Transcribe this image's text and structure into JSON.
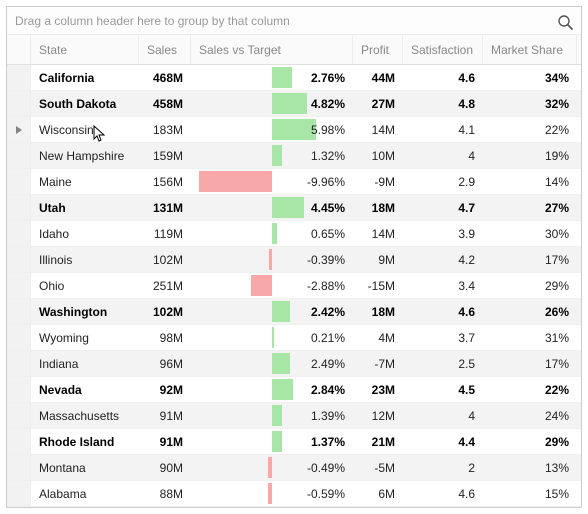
{
  "group_panel_text": "Drag a column header here to group by that column",
  "columns": {
    "state": "State",
    "sales": "Sales",
    "svt": "Sales vs Target",
    "profit": "Profit",
    "satisfaction": "Satisfaction",
    "market_share": "Market Share"
  },
  "svt_range": {
    "min": -10,
    "max": 10
  },
  "rows": [
    {
      "state": "California",
      "sales": "468M",
      "svt_text": "2.76%",
      "svt_val": 2.76,
      "profit": "44M",
      "satisfaction": "4.6",
      "market_share": "34%",
      "bold": true,
      "alt": false,
      "focused": false
    },
    {
      "state": "South Dakota",
      "sales": "458M",
      "svt_text": "4.82%",
      "svt_val": 4.82,
      "profit": "27M",
      "satisfaction": "4.8",
      "market_share": "32%",
      "bold": true,
      "alt": true,
      "focused": false
    },
    {
      "state": "Wisconsin",
      "sales": "183M",
      "svt_text": "5.98%",
      "svt_val": 5.98,
      "profit": "14M",
      "satisfaction": "4.1",
      "market_share": "22%",
      "bold": false,
      "alt": false,
      "focused": true
    },
    {
      "state": "New Hampshire",
      "sales": "159M",
      "svt_text": "1.32%",
      "svt_val": 1.32,
      "profit": "10M",
      "satisfaction": "4",
      "market_share": "19%",
      "bold": false,
      "alt": true,
      "focused": false
    },
    {
      "state": "Maine",
      "sales": "156M",
      "svt_text": "-9.96%",
      "svt_val": -9.96,
      "profit": "-9M",
      "satisfaction": "2.9",
      "market_share": "14%",
      "bold": false,
      "alt": false,
      "focused": false
    },
    {
      "state": "Utah",
      "sales": "131M",
      "svt_text": "4.45%",
      "svt_val": 4.45,
      "profit": "18M",
      "satisfaction": "4.7",
      "market_share": "27%",
      "bold": true,
      "alt": true,
      "focused": false
    },
    {
      "state": "Idaho",
      "sales": "119M",
      "svt_text": "0.65%",
      "svt_val": 0.65,
      "profit": "14M",
      "satisfaction": "3.9",
      "market_share": "30%",
      "bold": false,
      "alt": false,
      "focused": false
    },
    {
      "state": "Illinois",
      "sales": "102M",
      "svt_text": "-0.39%",
      "svt_val": -0.39,
      "profit": "9M",
      "satisfaction": "4.2",
      "market_share": "17%",
      "bold": false,
      "alt": true,
      "focused": false
    },
    {
      "state": "Ohio",
      "sales": "251M",
      "svt_text": "-2.88%",
      "svt_val": -2.88,
      "profit": "-15M",
      "satisfaction": "3.4",
      "market_share": "29%",
      "bold": false,
      "alt": false,
      "focused": false
    },
    {
      "state": "Washington",
      "sales": "102M",
      "svt_text": "2.42%",
      "svt_val": 2.42,
      "profit": "18M",
      "satisfaction": "4.6",
      "market_share": "26%",
      "bold": true,
      "alt": true,
      "focused": false
    },
    {
      "state": "Wyoming",
      "sales": "98M",
      "svt_text": "0.21%",
      "svt_val": 0.21,
      "profit": "4M",
      "satisfaction": "3.7",
      "market_share": "31%",
      "bold": false,
      "alt": false,
      "focused": false
    },
    {
      "state": "Indiana",
      "sales": "96M",
      "svt_text": "2.49%",
      "svt_val": 2.49,
      "profit": "-7M",
      "satisfaction": "2.5",
      "market_share": "17%",
      "bold": false,
      "alt": true,
      "focused": false
    },
    {
      "state": "Nevada",
      "sales": "92M",
      "svt_text": "2.84%",
      "svt_val": 2.84,
      "profit": "23M",
      "satisfaction": "4.5",
      "market_share": "22%",
      "bold": true,
      "alt": false,
      "focused": false
    },
    {
      "state": "Massachusetts",
      "sales": "91M",
      "svt_text": "1.39%",
      "svt_val": 1.39,
      "profit": "12M",
      "satisfaction": "4",
      "market_share": "24%",
      "bold": false,
      "alt": true,
      "focused": false
    },
    {
      "state": "Rhode Island",
      "sales": "91M",
      "svt_text": "1.37%",
      "svt_val": 1.37,
      "profit": "21M",
      "satisfaction": "4.4",
      "market_share": "29%",
      "bold": true,
      "alt": false,
      "focused": false
    },
    {
      "state": "Montana",
      "sales": "90M",
      "svt_text": "-0.49%",
      "svt_val": -0.49,
      "profit": "-5M",
      "satisfaction": "2",
      "market_share": "13%",
      "bold": false,
      "alt": true,
      "focused": false
    },
    {
      "state": "Alabama",
      "sales": "88M",
      "svt_text": "-0.59%",
      "svt_val": -0.59,
      "profit": "6M",
      "satisfaction": "4.6",
      "market_share": "15%",
      "bold": false,
      "alt": false,
      "focused": false
    }
  ]
}
